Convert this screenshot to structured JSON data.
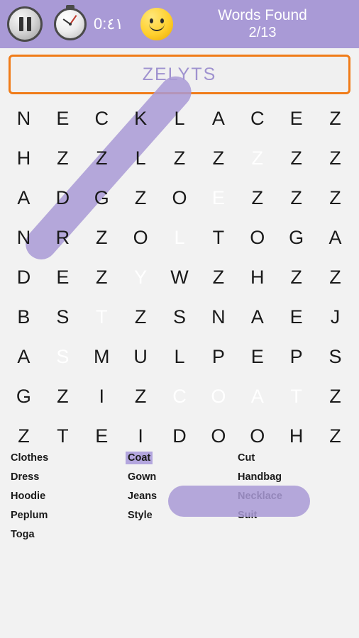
{
  "topbar": {
    "pause_icon": "pause-icon",
    "timer_icon": "stopwatch-icon",
    "timer_text": "0:٤١",
    "smiley_icon": "smiley-face-icon",
    "found_label": "Words Found",
    "found_count": "2/13"
  },
  "current_word": {
    "text": "ZELYTS"
  },
  "grid": {
    "rows": [
      [
        "N",
        "E",
        "C",
        "K",
        "L",
        "A",
        "C",
        "E",
        "Z"
      ],
      [
        "H",
        "Z",
        "Z",
        "L",
        "Z",
        "Z",
        "Z",
        "Z",
        "Z"
      ],
      [
        "A",
        "D",
        "G",
        "Z",
        "O",
        "E",
        "Z",
        "Z",
        "Z"
      ],
      [
        "N",
        "R",
        "Z",
        "O",
        "L",
        "T",
        "O",
        "G",
        "A"
      ],
      [
        "D",
        "E",
        "Z",
        "Y",
        "W",
        "Z",
        "H",
        "Z",
        "Z"
      ],
      [
        "B",
        "S",
        "T",
        "Z",
        "S",
        "N",
        "A",
        "E",
        "J"
      ],
      [
        "A",
        "S",
        "M",
        "U",
        "L",
        "P",
        "E",
        "P",
        "S"
      ],
      [
        "G",
        "Z",
        "I",
        "Z",
        "C",
        "O",
        "A",
        "T",
        "Z"
      ],
      [
        "Z",
        "T",
        "E",
        "I",
        "D",
        "O",
        "O",
        "H",
        "Z"
      ]
    ],
    "highlighted_cells": [
      {
        "row": 1,
        "col": 6
      },
      {
        "row": 2,
        "col": 5
      },
      {
        "row": 3,
        "col": 4
      },
      {
        "row": 4,
        "col": 3
      },
      {
        "row": 5,
        "col": 2
      },
      {
        "row": 6,
        "col": 1
      },
      {
        "row": 7,
        "col": 4
      },
      {
        "row": 7,
        "col": 5
      },
      {
        "row": 7,
        "col": 6
      },
      {
        "row": 7,
        "col": 7
      }
    ],
    "highlight_color": "#a99ad6"
  },
  "wordlist": {
    "columns": [
      [
        {
          "label": "Clothes",
          "found": false
        },
        {
          "label": "Dress",
          "found": false
        },
        {
          "label": "Hoodie",
          "found": false
        },
        {
          "label": "Peplum",
          "found": false
        },
        {
          "label": "Toga",
          "found": false
        }
      ],
      [
        {
          "label": "Coat",
          "found": true
        },
        {
          "label": "Gown",
          "found": false
        },
        {
          "label": "Jeans",
          "found": false
        },
        {
          "label": "Style",
          "found": false
        }
      ],
      [
        {
          "label": "Cut",
          "found": false
        },
        {
          "label": "Handbag",
          "found": false
        },
        {
          "label": "Necklace",
          "found": false
        },
        {
          "label": "Suit",
          "found": false
        }
      ]
    ]
  }
}
